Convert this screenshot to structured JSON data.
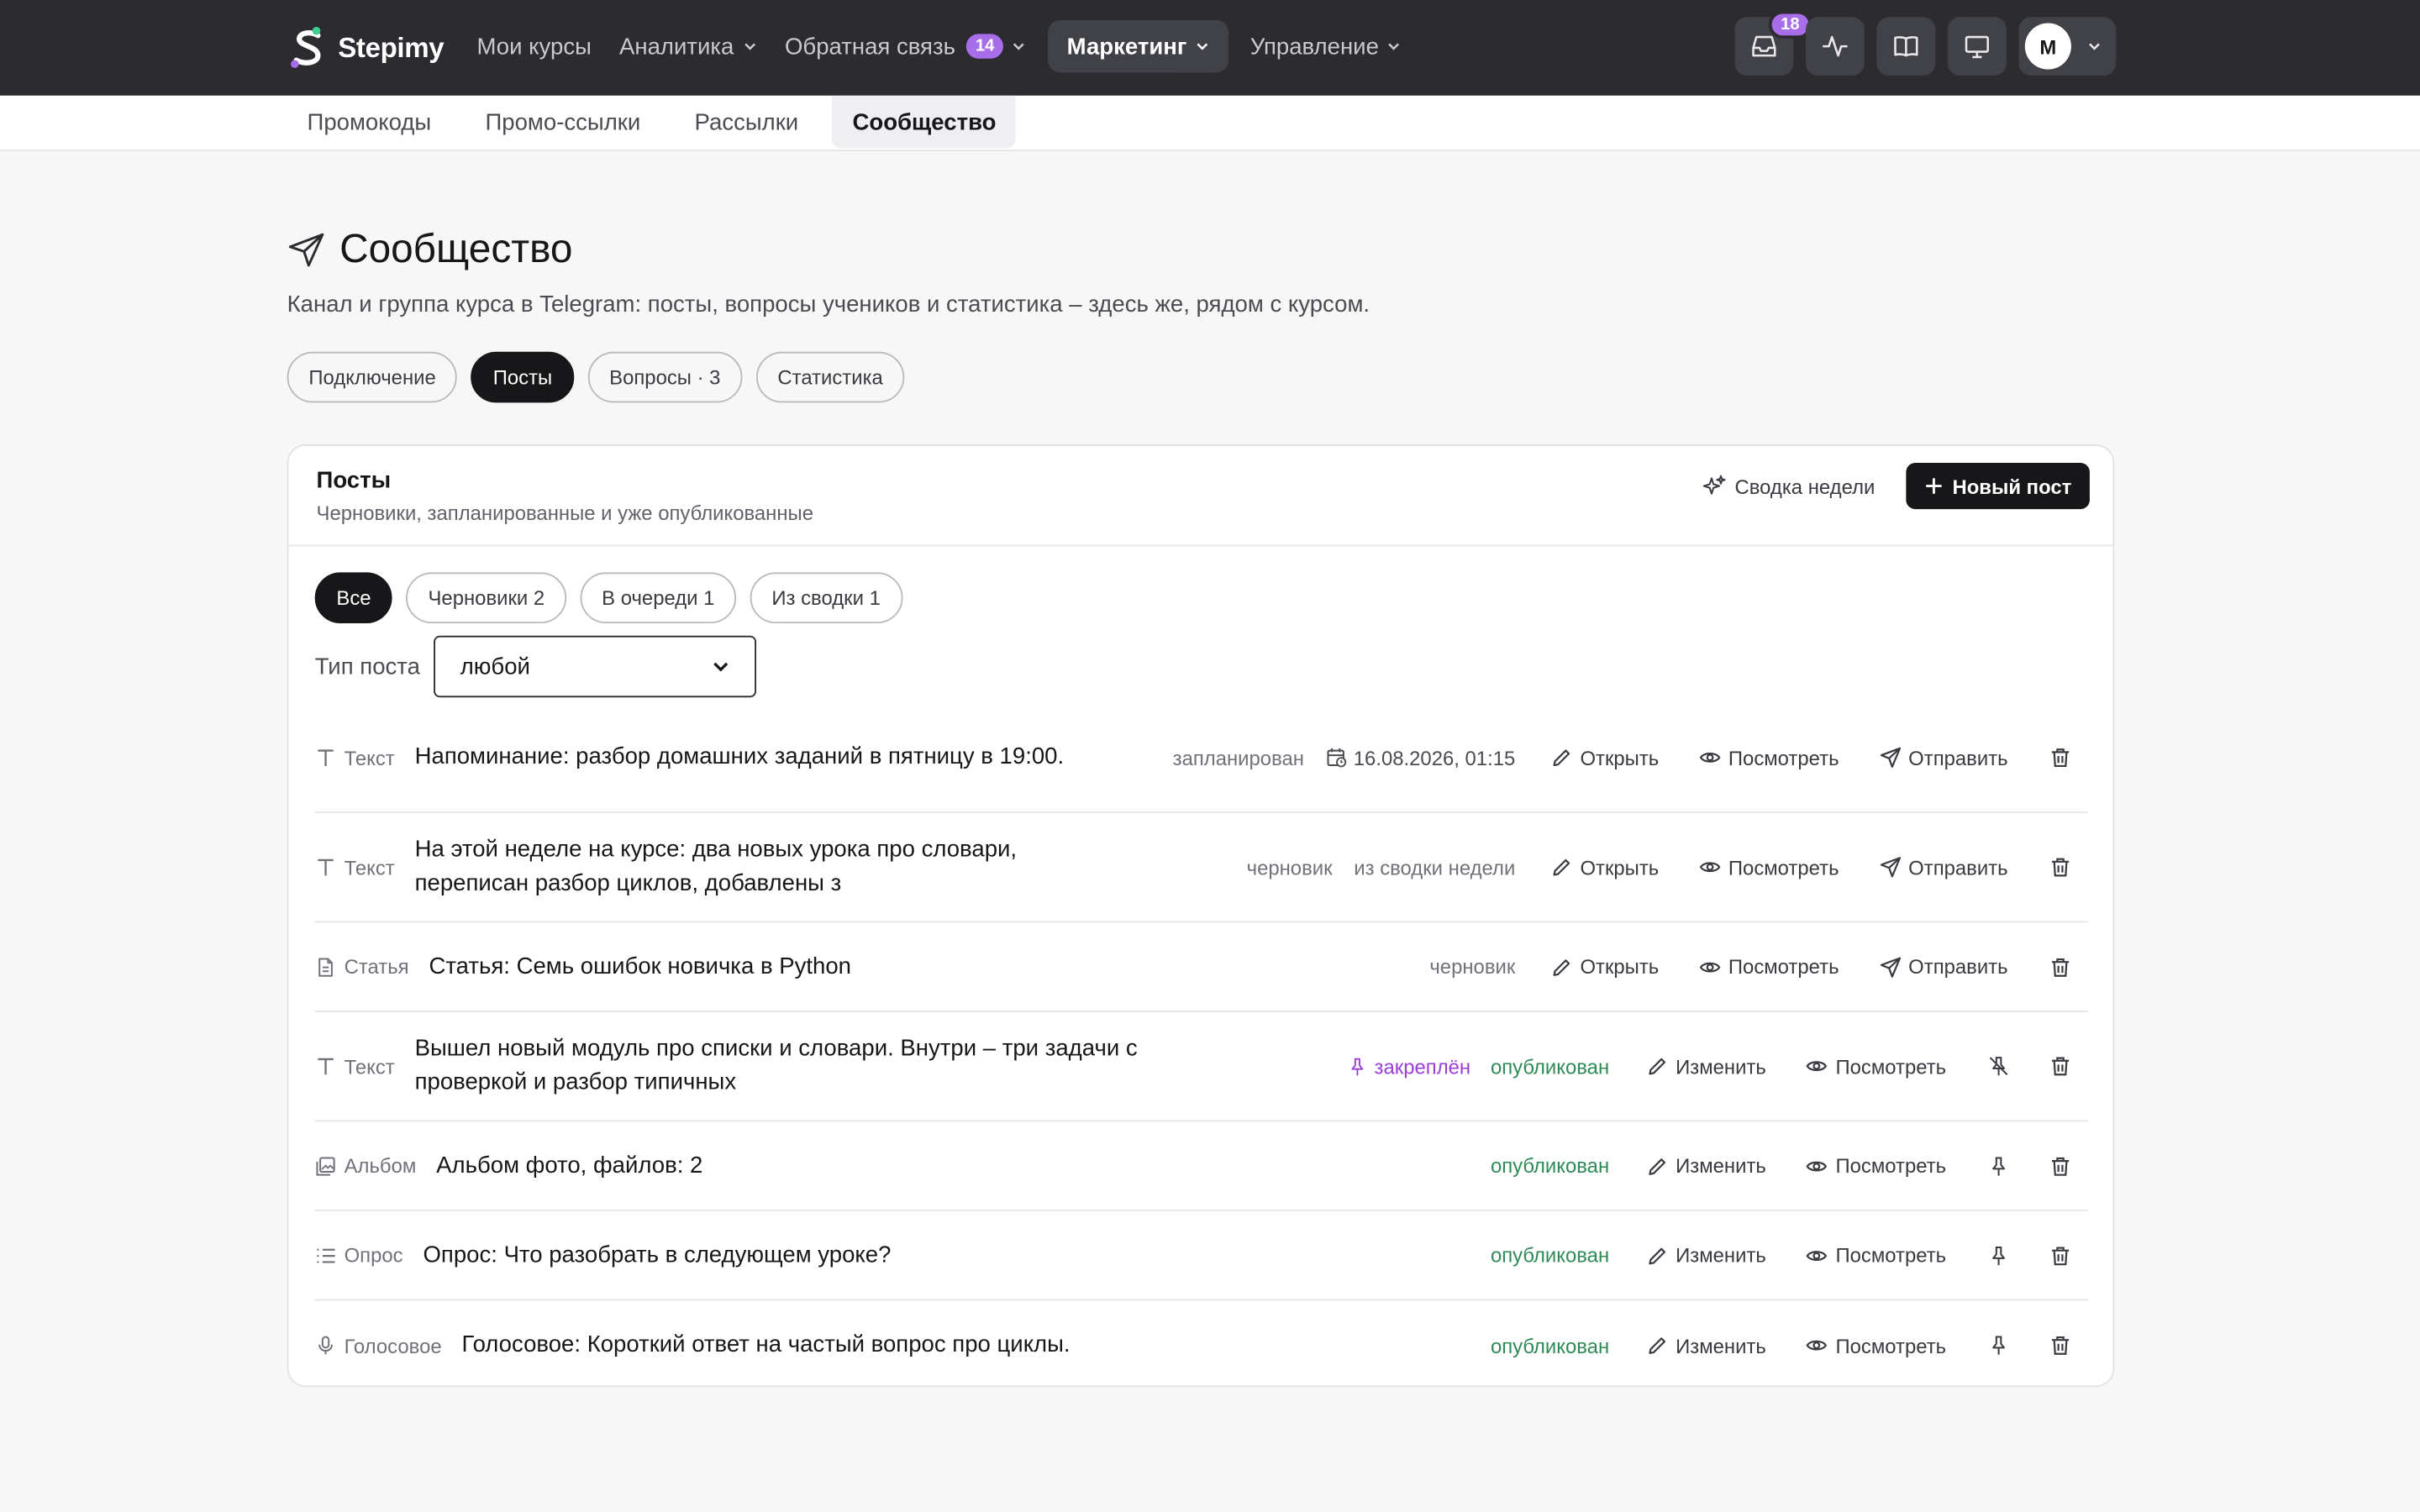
{
  "brand": {
    "name": "Stepimy"
  },
  "nav": {
    "my_courses": "Мои курсы",
    "analytics": "Аналитика",
    "feedback": "Обратная связь",
    "feedback_count": "14",
    "marketing": "Маркетинг",
    "management": "Управление"
  },
  "tools": {
    "inbox_count": "18",
    "user_initial": "М"
  },
  "subnav": {
    "promocodes": "Промокоды",
    "promo_links": "Промо-ссылки",
    "mailings": "Рассылки",
    "community": "Сообщество"
  },
  "page": {
    "title": "Сообщество",
    "description": "Канал и группа курса в Telegram: посты, вопросы учеников и статистика – здесь же, рядом с курсом."
  },
  "tabs": {
    "connection": "Подключение",
    "posts": "Посты",
    "questions": "Вопросы · 3",
    "stats": "Статистика"
  },
  "card": {
    "title": "Посты",
    "subtitle": "Черновики, запланированные и уже опубликованные",
    "digest_label": "Сводка недели",
    "new_post_label": "Новый пост"
  },
  "filters": {
    "all": "Все",
    "drafts": "Черновики 2",
    "queued": "В очереди 1",
    "from_digest": "Из сводки 1"
  },
  "type_filter": {
    "label": "Тип поста",
    "value": "любой"
  },
  "posts": [
    {
      "type": "Текст",
      "text": "Напоминание: разбор домашних заданий в пятницу в 19:00.",
      "status": "запланирован",
      "date": "16.08.2026, 01:15",
      "a1": "Открыть",
      "a2": "Посмотреть",
      "a3": "Отправить"
    },
    {
      "type": "Текст",
      "text": "На этой неделе на курсе: два новых урока про словари, переписан разбор циклов, добавлены з",
      "status": "черновик",
      "source": "из сводки недели",
      "a1": "Открыть",
      "a2": "Посмотреть",
      "a3": "Отправить"
    },
    {
      "type": "Статья",
      "text": "Статья: Семь ошибок новичка в Python",
      "status": "черновик",
      "a1": "Открыть",
      "a2": "Посмотреть",
      "a3": "Отправить"
    },
    {
      "type": "Текст",
      "text": "Вышел новый модуль про списки и словари. Внутри – три задачи с проверкой и разбор типичных",
      "pinned": "закреплён",
      "status": "опубликован",
      "a1": "Изменить",
      "a2": "Посмотреть"
    },
    {
      "type": "Альбом",
      "text": "Альбом фото, файлов: 2",
      "status": "опубликован",
      "a1": "Изменить",
      "a2": "Посмотреть"
    },
    {
      "type": "Опрос",
      "text": "Опрос: Что разобрать в следующем уроке?",
      "status": "опубликован",
      "a1": "Изменить",
      "a2": "Посмотреть"
    },
    {
      "type": "Голосовое",
      "text": "Голосовое: Короткий ответ на частый вопрос про циклы.",
      "status": "опубликован",
      "a1": "Изменить",
      "a2": "Посмотреть"
    }
  ],
  "colors": {
    "topbar": "#2b2b30",
    "accent_badge": "#a86de8",
    "published": "#2e8b57",
    "pinned": "#9b3fd8",
    "brand_green": "#3ecf8e"
  }
}
